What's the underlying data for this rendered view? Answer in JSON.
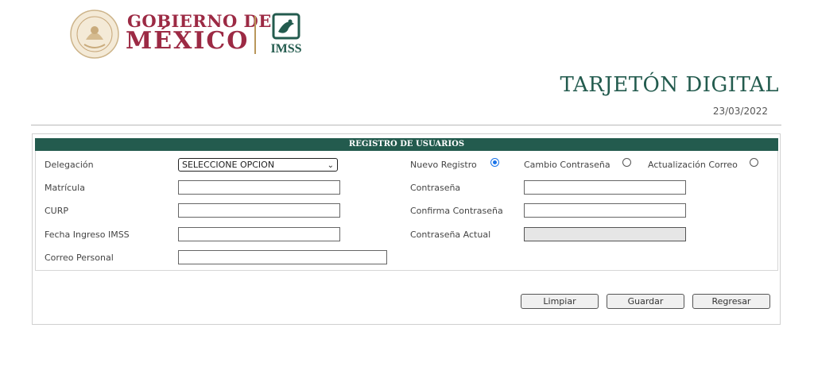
{
  "header": {
    "gob_line1": "GOBIERNO DE",
    "gob_line2": "MÉXICO",
    "seal_icon": "mexico-seal-icon",
    "imss_label": "IMSS",
    "imss_icon": "imss-eagle-icon",
    "brand_color": "#9c2a44",
    "accent_color": "#235b4e"
  },
  "page": {
    "title": "TARJETÓN DIGITAL",
    "date": "23/03/2022"
  },
  "form": {
    "title": "REGISTRO DE USUARIOS",
    "labels": {
      "delegacion": "Delegación",
      "matricula": "Matrícula",
      "curp": "CURP",
      "fecha_ingreso": "Fecha Ingreso IMSS",
      "correo_personal": "Correo Personal",
      "contrasena": "Contraseña",
      "confirma_contrasena": "Confirma Contraseña",
      "contrasena_actual": "Contraseña Actual"
    },
    "delegacion_select": {
      "selected": "SELECCIONE OPCION"
    },
    "options": {
      "nuevo_registro": "Nuevo Registro",
      "cambio_contrasena": "Cambio Contraseña",
      "actualizacion_correo": "Actualización Correo",
      "selected": "nuevo_registro"
    },
    "values": {
      "matricula": "",
      "curp": "",
      "fecha_ingreso": "",
      "correo_personal": "",
      "contrasena": "",
      "confirma_contrasena": "",
      "contrasena_actual": ""
    }
  },
  "buttons": {
    "limpiar": "Limpiar",
    "guardar": "Guardar",
    "regresar": "Regresar"
  }
}
